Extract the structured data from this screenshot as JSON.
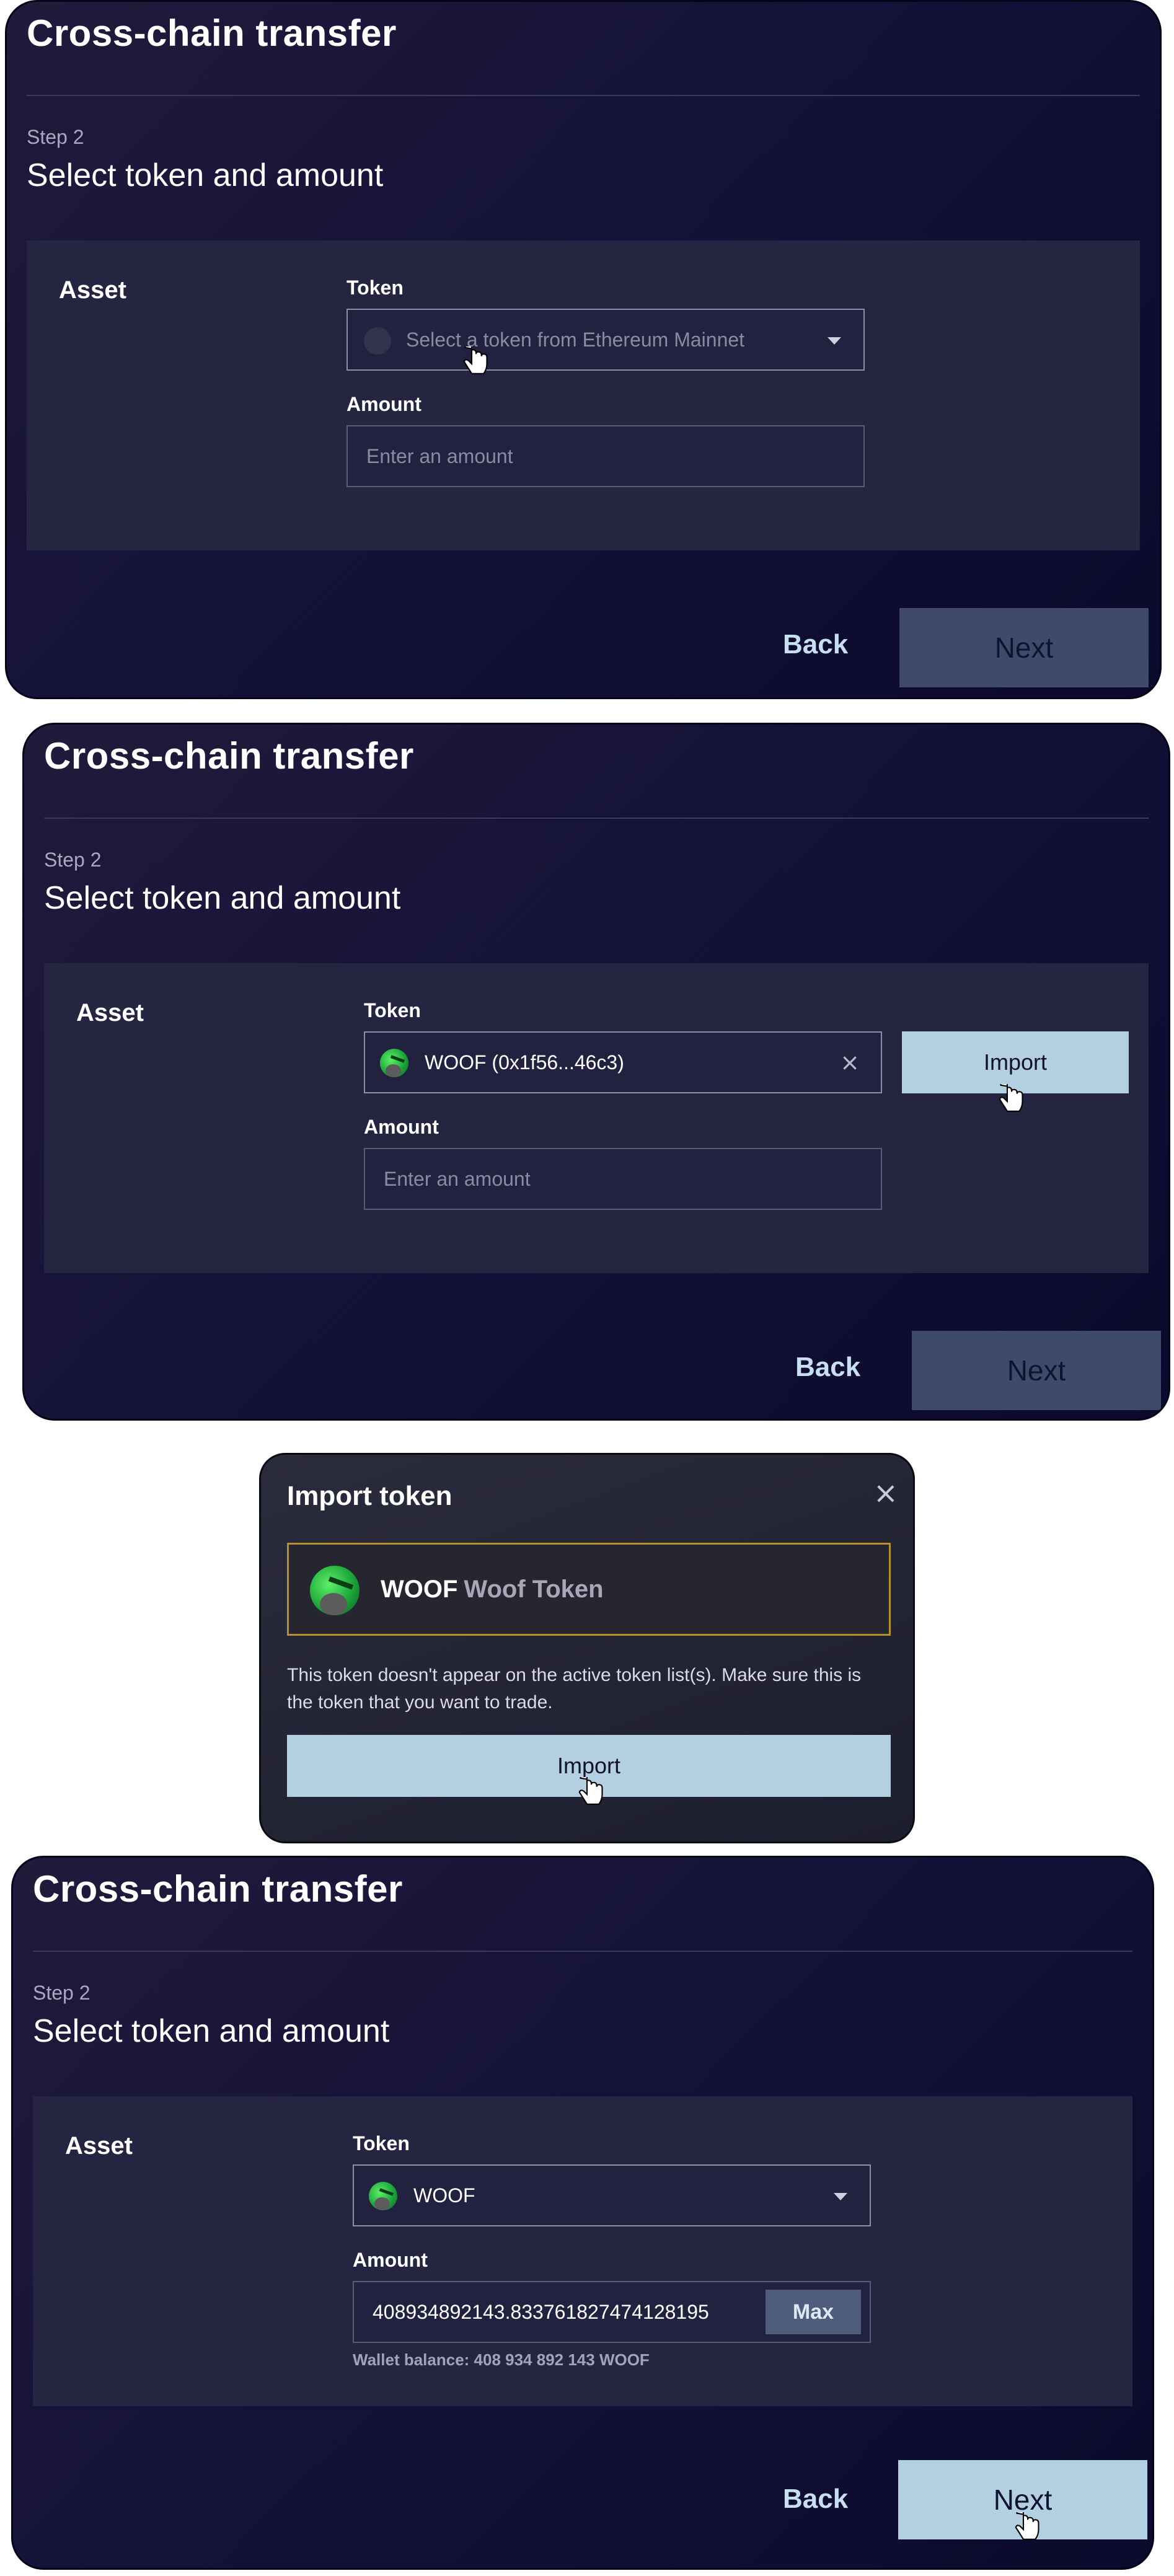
{
  "common": {
    "title": "Cross-chain transfer",
    "step_label": "Step 2",
    "step_title": "Select token and amount",
    "asset_label": "Asset",
    "token_label": "Token",
    "amount_label": "Amount",
    "amount_placeholder": "Enter an amount",
    "back_label": "Back",
    "next_label": "Next"
  },
  "frame1": {
    "token_placeholder": "Select a token from Ethereum Mainnet",
    "next_state": "disabled"
  },
  "frame2": {
    "token_value": "WOOF (0x1f56...46c3)",
    "clear_icon": "close-icon",
    "import_label": "Import",
    "next_state": "disabled"
  },
  "modal": {
    "title": "Import token",
    "token_symbol": "WOOF",
    "token_name": "Woof Token",
    "warning": "This token doesn't appear on the active token list(s). Make sure this is the token that you want to trade.",
    "import_label": "Import"
  },
  "frame4": {
    "token_value": "WOOF",
    "amount_value": "408934892143.833761827474128195",
    "max_label": "Max",
    "balance": "Wallet balance: 408 934 892 143 WOOF",
    "next_state": "enabled"
  },
  "colors": {
    "card_bg": "#141238",
    "panel_bg": "#262541",
    "button_light": "#b3cfe2",
    "button_disabled": "#3f4a6b",
    "modal_border_accent": "#b8902a"
  },
  "icons": [
    "chevron-down-icon",
    "close-icon",
    "woof-token-icon",
    "hand-cursor-icon"
  ]
}
